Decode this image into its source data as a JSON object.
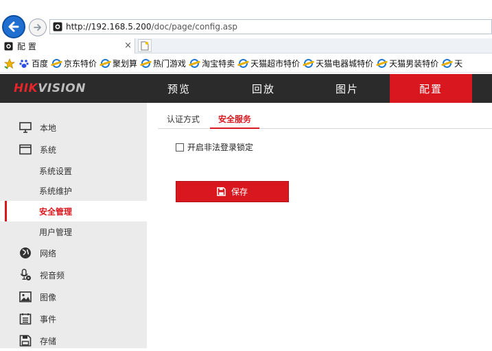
{
  "browser": {
    "url_host": "http://192.168.5.200",
    "url_path": "/doc/page/config.asp",
    "tab_title": "配 置",
    "favorites": [
      "百度",
      "京东特价",
      "聚划算",
      "热门游戏",
      "淘宝特卖",
      "天猫超市特价",
      "天猫电器城特价",
      "天猫男装特价",
      "天"
    ]
  },
  "header": {
    "logo_red": "HIK",
    "logo_grey": "VISION",
    "menu": [
      "预览",
      "回放",
      "图片",
      "配置"
    ],
    "active_menu": "配置"
  },
  "sidebar": {
    "items": [
      {
        "label": "本地",
        "icon": "monitor-icon"
      },
      {
        "label": "系统",
        "icon": "window-icon"
      },
      {
        "label": "系统设置",
        "sub": true
      },
      {
        "label": "系统维护",
        "sub": true
      },
      {
        "label": "安全管理",
        "sub": true,
        "active": true
      },
      {
        "label": "用户管理",
        "sub": true
      },
      {
        "label": "网络",
        "icon": "globe-icon"
      },
      {
        "label": "视音频",
        "icon": "microphone-icon"
      },
      {
        "label": "图像",
        "icon": "image-icon"
      },
      {
        "label": "事件",
        "icon": "calendar-list-icon"
      },
      {
        "label": "存储",
        "icon": "floppy-icon"
      }
    ]
  },
  "main": {
    "tabs": [
      {
        "label": "认证方式",
        "active": false
      },
      {
        "label": "安全服务",
        "active": true
      }
    ],
    "checkbox_label": "开启非法登录锁定",
    "checkbox_checked": false,
    "save_label": "保存"
  },
  "colors": {
    "accent": "#d9171e",
    "header_bg": "#2b2b2b",
    "sidebar_bg": "#ebebeb",
    "browser_blue": "#1f6fd0"
  }
}
